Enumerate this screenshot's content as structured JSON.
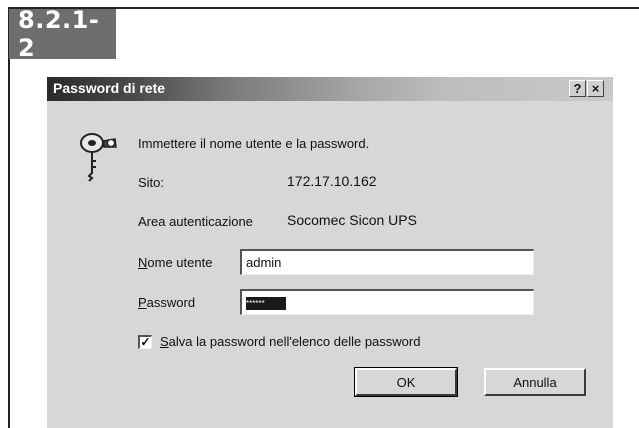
{
  "section_tag": "8.2.1-2",
  "dialog": {
    "title": "Password di rete",
    "help_button": "?",
    "close_button": "×",
    "instruction": "Immettere il nome utente e la password.",
    "site_label": "Sito:",
    "site_value": "172.17.10.162",
    "realm_label": "Area autenticazione",
    "realm_value": "Socomec Sicon UPS",
    "username_label_mnemonic": "N",
    "username_label_rest": "ome utente",
    "username_value": "admin",
    "password_label_mnemonic": "P",
    "password_label_rest": "assword",
    "password_mask": "******",
    "save_checkbox_mark": "✓",
    "save_label_mnemonic": "S",
    "save_label_rest": "alva la password nell'elenco delle password",
    "ok_label": "OK",
    "cancel_label": "Annulla"
  },
  "icons": {
    "key": "key-icon"
  }
}
